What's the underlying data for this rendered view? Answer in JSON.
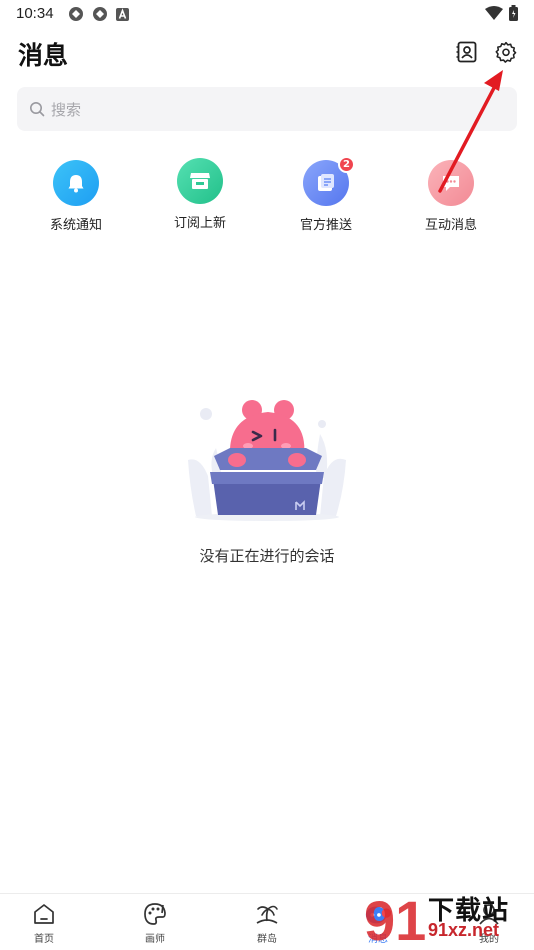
{
  "status_bar": {
    "time": "10:34"
  },
  "header": {
    "title": "消息",
    "contacts_icon": "contacts-card-icon",
    "settings_icon": "gear-icon"
  },
  "search": {
    "placeholder": "搜索"
  },
  "entries": [
    {
      "label": "系统通知",
      "icon": "bell-icon",
      "color": "#2fb2f5",
      "badge": ""
    },
    {
      "label": "订阅上新",
      "icon": "shop-icon",
      "color": "#39d3a0",
      "badge": ""
    },
    {
      "label": "官方推送",
      "icon": "document-icon",
      "color": "#6d8ff6",
      "badge": "2"
    },
    {
      "label": "互动消息",
      "icon": "chat-bubble-icon",
      "color": "#f7a0a8",
      "badge": ""
    }
  ],
  "empty_state": {
    "text": "没有正在进行的会话"
  },
  "bottom_nav": {
    "items": [
      {
        "label": "首页",
        "icon": "home-icon"
      },
      {
        "label": "画师",
        "icon": "palette-icon"
      },
      {
        "label": "群岛",
        "icon": "island-icon"
      },
      {
        "label": "消息",
        "icon": "message-icon",
        "active": true
      },
      {
        "label": "我的",
        "icon": "profile-icon"
      }
    ]
  },
  "watermark": {
    "title": "下载站",
    "site": "91xz.net",
    "badge": "91"
  },
  "colors": {
    "active": "#3d7ff6",
    "annotation_arrow": "#e21b22",
    "badge": "#f0454f"
  }
}
